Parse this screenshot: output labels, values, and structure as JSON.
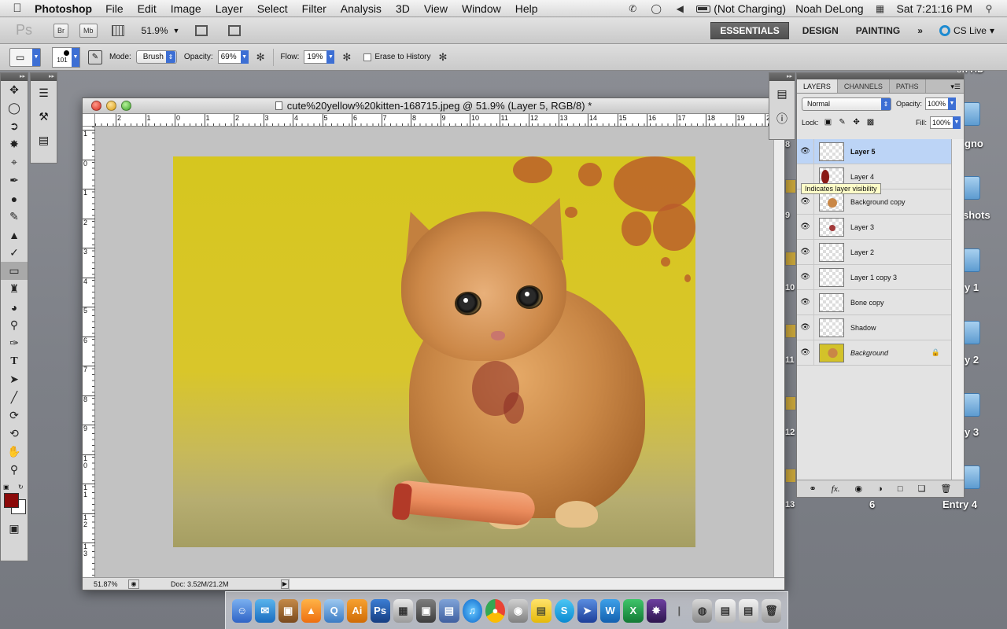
{
  "menubar": {
    "apple": "",
    "app": "Photoshop",
    "items": [
      "File",
      "Edit",
      "Image",
      "Layer",
      "Select",
      "Filter",
      "Analysis",
      "3D",
      "View",
      "Window",
      "Help"
    ],
    "battery": "(Not Charging)",
    "user": "Noah DeLong",
    "clock": "Sat 7:21:16 PM"
  },
  "appbar": {
    "logo": "Ps",
    "bridge": "Br",
    "minibridge": "Mb",
    "zoom": "51.9%",
    "workspaces": [
      "ESSENTIALS",
      "DESIGN",
      "PAINTING"
    ],
    "more": "»",
    "cslive": "CS Live"
  },
  "options": {
    "brush_size": "101",
    "mode_label": "Mode:",
    "mode_value": "Brush",
    "opacity_label": "Opacity:",
    "opacity_value": "69%",
    "flow_label": "Flow:",
    "flow_value": "19%",
    "erase_history": "Erase to History"
  },
  "document": {
    "title": "cute%20yellow%20kitten-168715.jpeg @ 51.9% (Layer 5, RGB/8) *",
    "zoom_status": "51.87%",
    "doc_size": "Doc: 3.52M/21.2M",
    "ruler_h": [
      "2",
      "1",
      "0",
      "1",
      "2",
      "3",
      "4",
      "5",
      "6",
      "7",
      "8",
      "9",
      "10",
      "11",
      "12",
      "13",
      "14",
      "15",
      "16",
      "17",
      "18",
      "19",
      "20"
    ],
    "ruler_v": [
      "1",
      "0",
      "1",
      "2",
      "3",
      "4",
      "5",
      "6",
      "7",
      "8",
      "9",
      "1\n0",
      "1\n1",
      "1\n2",
      "1\n3"
    ]
  },
  "layers_panel": {
    "tabs": [
      "LAYERS",
      "CHANNELS",
      "PATHS"
    ],
    "blend_mode": "Normal",
    "opacity_label": "Opacity:",
    "opacity_value": "100%",
    "lock_label": "Lock:",
    "fill_label": "Fill:",
    "fill_value": "100%",
    "tooltip": "Indicates layer visibility",
    "layers": [
      {
        "name": "Layer 5",
        "visible": true,
        "selected": true
      },
      {
        "name": "Layer 4",
        "visible": false,
        "selected": false
      },
      {
        "name": "Background copy",
        "visible": true,
        "selected": false
      },
      {
        "name": "Layer 3",
        "visible": true,
        "selected": false
      },
      {
        "name": "Layer 2",
        "visible": true,
        "selected": false
      },
      {
        "name": "Layer 1 copy 3",
        "visible": true,
        "selected": false
      },
      {
        "name": "Bone copy",
        "visible": true,
        "selected": false
      },
      {
        "name": "Shadow",
        "visible": true,
        "selected": false
      },
      {
        "name": "Background",
        "visible": true,
        "selected": false,
        "locked": true
      }
    ]
  },
  "desktop": {
    "labels": [
      "gno",
      "shots",
      "y 1",
      "y 2",
      "y 3",
      "6",
      "Entry 4",
      "sh HD"
    ],
    "numbers": [
      "8",
      "9",
      "10",
      "11",
      "12",
      "13"
    ]
  },
  "colors": {
    "foreground": "#8b0a0a",
    "background": "#ffffff",
    "selection": "#bcd4f6",
    "accent": "#3d6fd4"
  }
}
